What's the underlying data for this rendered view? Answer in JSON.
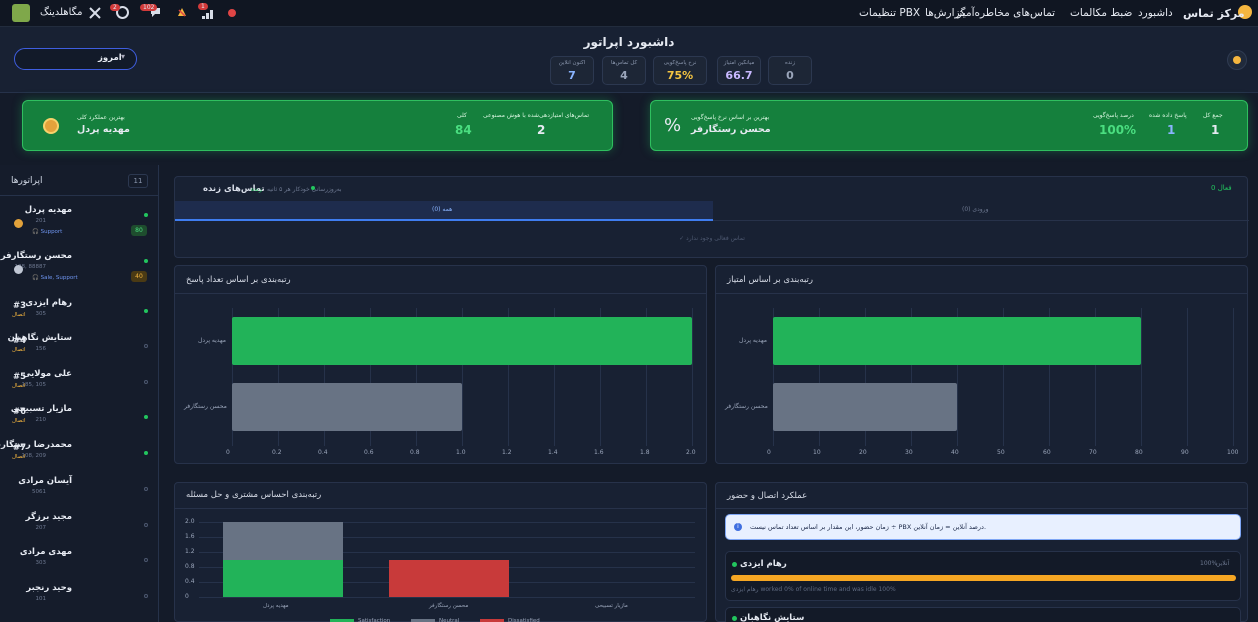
{
  "topbar": {
    "brand": "مرکز تماس",
    "menu": [
      "داشبورد",
      "ضبط مکالمات",
      "تماس‌های مخاطره‌آمیز",
      "گزارش‌ها",
      "تنظیمات PBX"
    ],
    "user": "مگاهلدینگ",
    "badges": [
      "2",
      "102",
      "1"
    ]
  },
  "header": {
    "title": "داشبورد اپراتور",
    "period": "امروز",
    "stats": [
      {
        "label": "زنده",
        "value": "0",
        "color": "#9aa5ba"
      },
      {
        "label": "میانگین امتیاز",
        "value": "66.7",
        "color": "#c8b8ff"
      },
      {
        "label": "نرخ پاسخ‌گویی",
        "value": "75%",
        "color": "#f5c542"
      },
      {
        "label": "کل تماس‌ها",
        "value": "4",
        "color": "#9aa5ba"
      },
      {
        "label": "اکنون آنلاین",
        "value": "7",
        "color": "#8ab4ff"
      }
    ]
  },
  "cards": {
    "response": {
      "title": "بهترین بر اساس نرخ پاسخ‌گویی",
      "name": "محسن رستگارفر",
      "labels": [
        "جمع کل",
        "پاسخ داده شده",
        "درصد پاسخ‌گویی"
      ],
      "values": [
        "1",
        "1",
        "100%"
      ]
    },
    "overall": {
      "title": "بهترین عملکرد کلی",
      "name": "مهدیه پردل",
      "labels": [
        "کلی",
        "تماس‌های امتیازدهی‌شده با هوش مصنوعی"
      ],
      "values": [
        "84",
        "2"
      ]
    }
  },
  "sidebar": {
    "title": "اپراتورها",
    "count": "11",
    "operators": [
      {
        "name": "مهدیه پردل",
        "ext": "201",
        "tag": "Support",
        "score": "80",
        "online": true,
        "rank": "medal-gold"
      },
      {
        "name": "محسن رستگارفر",
        "ext": "108, 88887",
        "tag": "Sale, Support",
        "score": "40",
        "online": true,
        "rank": "medal-silver"
      },
      {
        "name": "رهام ایزدی",
        "ext": "305",
        "rank": "#3",
        "status": "اتصال",
        "online": true
      },
      {
        "name": "ستایش نگاهبان",
        "ext": "156",
        "rank": "#4",
        "status": "اتصال",
        "online": false
      },
      {
        "name": "علی مولایی",
        "ext": "185, 105",
        "rank": "#5",
        "status": "اتصال",
        "online": false
      },
      {
        "name": "مازیار تسبیحی",
        "ext": "210",
        "rank": "#6",
        "status": "اتصال",
        "online": true
      },
      {
        "name": "محمدرضا رستگارفر",
        "ext": "108, 209",
        "rank": "#7",
        "status": "اتصال",
        "online": true
      },
      {
        "name": "آیسان مرادی",
        "ext": "5061",
        "online": false
      },
      {
        "name": "مجید برزگر",
        "ext": "207",
        "online": false
      },
      {
        "name": "مهدی مرادی",
        "ext": "303",
        "online": false
      },
      {
        "name": "وحید رنجبر",
        "ext": "101",
        "online": false
      }
    ]
  },
  "live": {
    "title": "تماس‌های زنده",
    "badge": "زنده",
    "note": "به‌روزرسانی خودکار هر ۵ ثانیه",
    "active": "فعال 0",
    "tabs": [
      "همه (0)",
      "ورودی (0)"
    ],
    "empty": "✓ تماس فعالی وجود ندارد"
  },
  "chart_data": [
    {
      "type": "bar",
      "title": "رتبه‌بندی بر اساس تعداد پاسخ",
      "categories": [
        "مهدیه پردل",
        "محسن رستگارفر"
      ],
      "values": [
        2,
        1
      ],
      "xlim": [
        0,
        2
      ],
      "ticks": [
        "0",
        "0.2",
        "0.4",
        "0.6",
        "0.8",
        "1.0",
        "1.2",
        "1.4",
        "1.6",
        "1.8",
        "2.0"
      ],
      "colors": [
        "#22b359",
        "#687384"
      ]
    },
    {
      "type": "bar",
      "title": "رتبه‌بندی بر اساس امتیاز",
      "categories": [
        "مهدیه پردل",
        "محسن رستگارفر"
      ],
      "values": [
        80,
        40
      ],
      "xlim": [
        0,
        100
      ],
      "ticks": [
        "0",
        "10",
        "20",
        "30",
        "40",
        "50",
        "60",
        "70",
        "80",
        "90",
        "100"
      ],
      "colors": [
        "#22b359",
        "#687384"
      ]
    },
    {
      "type": "bar",
      "title": "رتبه‌بندی احساس مشتری و حل مسئله",
      "categories": [
        "مهدیه پردل",
        "محسن رستگارفر",
        "مازیار تسبیحی"
      ],
      "series": [
        {
          "name": "Satisfaction",
          "values": [
            1,
            0,
            0
          ],
          "color": "#22b359"
        },
        {
          "name": "Neutral",
          "values": [
            1,
            0,
            0
          ],
          "color": "#687384"
        },
        {
          "name": "Dissatisfied",
          "values": [
            0,
            1,
            0
          ],
          "color": "#c83a3a"
        }
      ],
      "ylim": [
        0,
        2
      ],
      "ticks": [
        "0",
        "0.4",
        "0.8",
        "1.2",
        "1.6",
        "2.0"
      ]
    }
  ],
  "perf": {
    "title": "عملکرد اتصال و حضور",
    "info": "زمان حضور، این مقدار بر اساس تعداد تماس نیست ÷ PBX درصد آنلاین = زمان آنلاین.",
    "rows": [
      {
        "name": "رهام ایزدی",
        "pct": "100%",
        "label": "آنلاین",
        "detail": "رهام ایزدی worked 0% of online time and was idle 100%"
      },
      {
        "name": "ستایش نگاهبان"
      }
    ]
  }
}
